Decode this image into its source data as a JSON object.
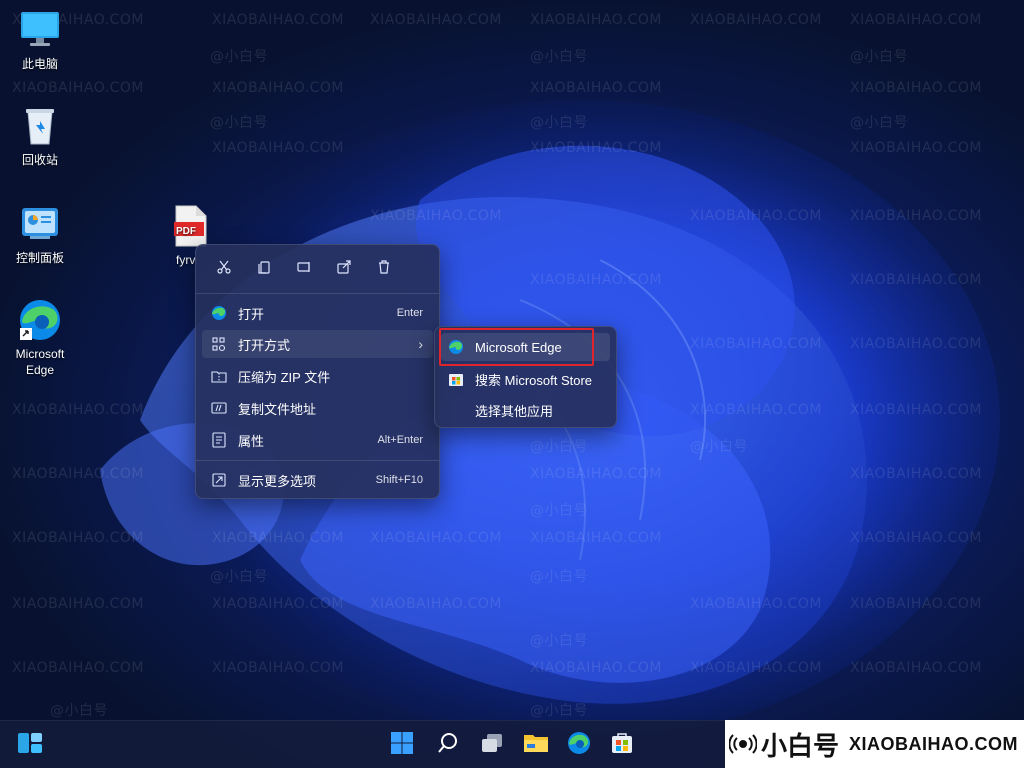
{
  "desktop": {
    "icons": [
      {
        "label": "此电脑",
        "icon": "monitor-icon"
      },
      {
        "label": "回收站",
        "icon": "recycle-bin-icon"
      },
      {
        "label": "控制面板",
        "icon": "control-panel-icon"
      },
      {
        "label": "Microsoft Edge",
        "icon": "edge-icon"
      },
      {
        "label": "fyrv",
        "icon": "pdf-file-icon"
      }
    ],
    "pdf_badge": "PDF"
  },
  "watermark": {
    "site": "XIAOBAIHAO.COM",
    "handle": "@小白号"
  },
  "context_menu": {
    "toolbar": [
      "cut-icon",
      "copy-icon",
      "rename-icon",
      "share-icon",
      "delete-icon"
    ],
    "items": [
      {
        "label": "打开",
        "shortcut": "Enter",
        "icon": "edge-icon"
      },
      {
        "label": "打开方式",
        "shortcut": "",
        "icon": "open-with-icon",
        "has_submenu": true,
        "arrow": "›"
      },
      {
        "label": "压缩为 ZIP 文件",
        "shortcut": "",
        "icon": "zip-folder-icon"
      },
      {
        "label": "复制文件地址",
        "shortcut": "",
        "icon": "copy-path-icon"
      },
      {
        "label": "属性",
        "shortcut": "Alt+Enter",
        "icon": "properties-icon"
      },
      {
        "label": "显示更多选项",
        "shortcut": "Shift+F10",
        "icon": "more-options-icon"
      }
    ]
  },
  "submenu": {
    "items": [
      {
        "label": "Microsoft Edge",
        "icon": "edge-icon",
        "highlighted": true
      },
      {
        "label": "搜索 Microsoft Store",
        "icon": "store-icon"
      },
      {
        "label": "选择其他应用",
        "icon": ""
      }
    ]
  },
  "taskbar": {
    "icons": [
      "widgets-icon",
      "start-icon",
      "search-icon",
      "task-view-icon",
      "file-explorer-icon",
      "edge-icon",
      "store-icon"
    ]
  },
  "brand": {
    "name": "小白号",
    "site": "XIAOBAIHAO.COM"
  },
  "colors": {
    "highlight_border": "#e0242b",
    "menu_bg": "#26305c",
    "edge_blue": "#0c8ae8",
    "edge_green": "#4fd16a"
  }
}
